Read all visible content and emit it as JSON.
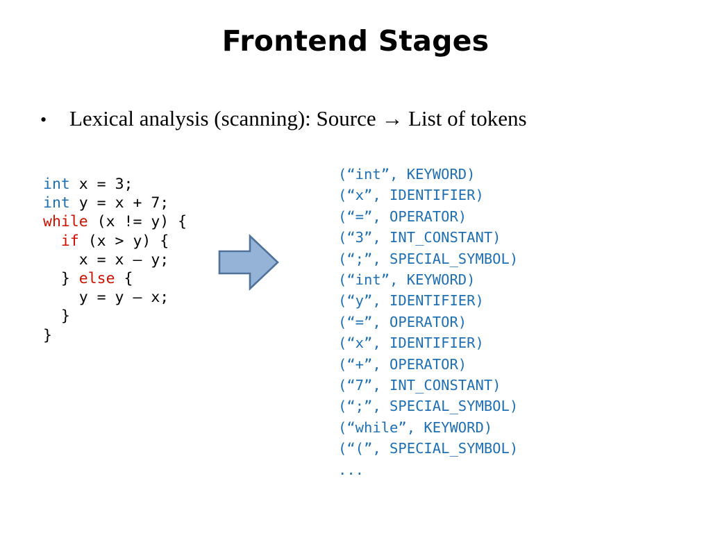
{
  "slide": {
    "title": "Frontend Stages",
    "background_color": "#FFFFFF"
  },
  "bullet": {
    "marker": "•",
    "text": "Lexical analysis (scanning): Source → List of tokens"
  },
  "code_block": {
    "language": "c",
    "keyword_blue": "#1F6FB5",
    "keyword_red": "#CC1100",
    "text_color": "#000000",
    "lines": [
      {
        "indent": "",
        "keyword": "int",
        "keyword_color": "blue",
        "rest": " x = 3;"
      },
      {
        "indent": "",
        "keyword": "int",
        "keyword_color": "blue",
        "rest": " y = x + 7;"
      },
      {
        "indent": "",
        "keyword": "while",
        "keyword_color": "red",
        "rest": " (x != y) {"
      },
      {
        "indent": "  ",
        "keyword": "if",
        "keyword_color": "red",
        "rest": " (x > y) {"
      },
      {
        "indent": "    ",
        "keyword": "",
        "keyword_color": "none",
        "rest": "x = x – y;"
      },
      {
        "indent": "  ",
        "keyword": "else",
        "keyword_color": "red",
        "prefix": "} ",
        "rest": " {"
      },
      {
        "indent": "    ",
        "keyword": "",
        "keyword_color": "none",
        "rest": "y = y – x;"
      },
      {
        "indent": "  ",
        "keyword": "",
        "keyword_color": "none",
        "rest": "}"
      },
      {
        "indent": "",
        "keyword": "",
        "keyword_color": "none",
        "rest": "}"
      }
    ],
    "plain_text": "int x = 3;\nint y = x + 7;\nwhile (x != y) {\n  if (x > y) {\n    x – y;\n  } else {\n    y = y – x;\n  }\n}"
  },
  "arrow": {
    "direction": "right",
    "fill_color": "#95B3D7",
    "stroke_color": "#4F719A"
  },
  "token_list": {
    "text_color": "#1F6FB5",
    "lines": [
      "(“int”, KEYWORD)",
      "(“x”, IDENTIFIER)",
      "(“=”, OPERATOR)",
      "(“3”, INT_CONSTANT)",
      "(“;”, SPECIAL_SYMBOL)",
      "(“int”, KEYWORD)",
      "(“y”, IDENTIFIER)",
      "(“=”, OPERATOR)",
      "(“x”, IDENTIFIER)",
      "(“+”, OPERATOR)",
      "(“7”, INT_CONSTANT)",
      "(“;”, SPECIAL_SYMBOL)",
      "(“while”, KEYWORD)",
      "(“(”, SPECIAL_SYMBOL)",
      "..."
    ]
  }
}
